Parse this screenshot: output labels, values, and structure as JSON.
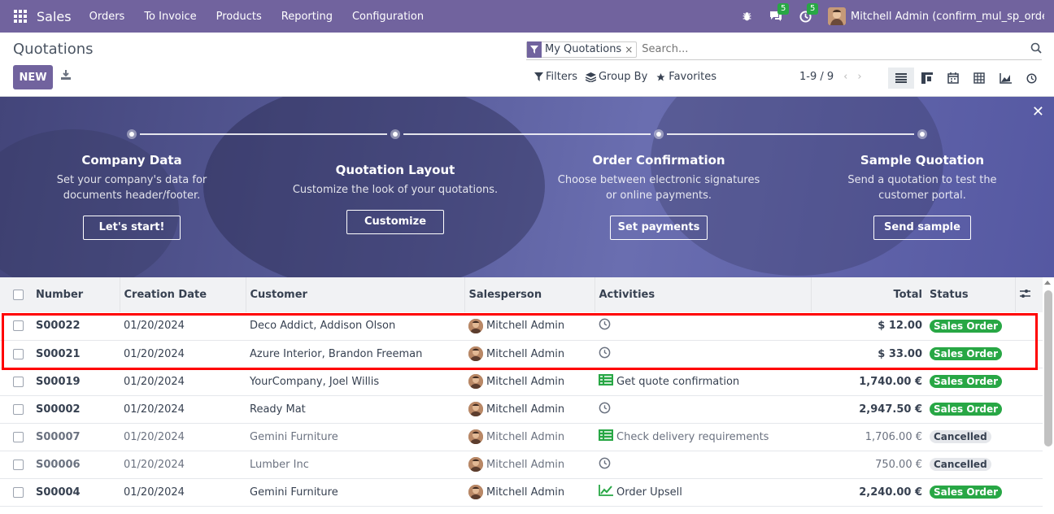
{
  "navbar": {
    "brand": "Sales",
    "menu": [
      "Orders",
      "To Invoice",
      "Products",
      "Reporting",
      "Configuration"
    ],
    "messages_count": "5",
    "activities_count": "5",
    "user": "Mitchell Admin (confirm_mul_sp_orde..."
  },
  "control_panel": {
    "title": "Quotations",
    "new_label": "NEW",
    "facet_label": "My Quotations",
    "search_placeholder": "Search...",
    "filters_label": "Filters",
    "groupby_label": "Group By",
    "favorites_label": "Favorites",
    "pager": "1-9 / 9"
  },
  "banner": {
    "steps": [
      {
        "title": "Company Data",
        "desc": "Set your company's data for documents header/footer.",
        "button": "Let's start!"
      },
      {
        "title": "Quotation Layout",
        "desc": "Customize the look of your quotations.",
        "button": "Customize"
      },
      {
        "title": "Order Confirmation",
        "desc": "Choose between electronic signatures or online payments.",
        "button": "Set payments"
      },
      {
        "title": "Sample Quotation",
        "desc": "Send a quotation to test the customer portal.",
        "button": "Send sample"
      }
    ]
  },
  "table": {
    "headers": {
      "number": "Number",
      "date": "Creation Date",
      "customer": "Customer",
      "salesperson": "Salesperson",
      "activities": "Activities",
      "total": "Total",
      "status": "Status"
    },
    "rows": [
      {
        "number": "S00022",
        "date": "01/20/2024",
        "customer": "Deco Addict, Addison Olson",
        "salesperson": "Mitchell Admin",
        "activity": "",
        "activity_icon": "clock",
        "total": "$ 12.00",
        "status": "Sales Order",
        "cancelled": false
      },
      {
        "number": "S00021",
        "date": "01/20/2024",
        "customer": "Azure Interior, Brandon Freeman",
        "salesperson": "Mitchell Admin",
        "activity": "",
        "activity_icon": "clock",
        "total": "$ 33.00",
        "status": "Sales Order",
        "cancelled": false
      },
      {
        "number": "S00019",
        "date": "01/20/2024",
        "customer": "YourCompany, Joel Willis",
        "salesperson": "Mitchell Admin",
        "activity": "Get quote confirmation",
        "activity_icon": "list",
        "total": "1,740.00 €",
        "status": "Sales Order",
        "cancelled": false
      },
      {
        "number": "S00002",
        "date": "01/20/2024",
        "customer": "Ready Mat",
        "salesperson": "Mitchell Admin",
        "activity": "",
        "activity_icon": "clock",
        "total": "2,947.50 €",
        "status": "Sales Order",
        "cancelled": false
      },
      {
        "number": "S00007",
        "date": "01/20/2024",
        "customer": "Gemini Furniture",
        "salesperson": "Mitchell Admin",
        "activity": "Check delivery requirements",
        "activity_icon": "list",
        "total": "1,706.00 €",
        "status": "Cancelled",
        "cancelled": true
      },
      {
        "number": "S00006",
        "date": "01/20/2024",
        "customer": "Lumber Inc",
        "salesperson": "Mitchell Admin",
        "activity": "",
        "activity_icon": "clock",
        "total": "750.00 €",
        "status": "Cancelled",
        "cancelled": true
      },
      {
        "number": "S00004",
        "date": "01/20/2024",
        "customer": "Gemini Furniture",
        "salesperson": "Mitchell Admin",
        "activity": "Order Upsell",
        "activity_icon": "chart",
        "total": "2,240.00 €",
        "status": "Sales Order",
        "cancelled": false
      }
    ]
  },
  "colors": {
    "brand": "#71639e",
    "status_green": "#28a745",
    "highlight": "#ff0000"
  }
}
